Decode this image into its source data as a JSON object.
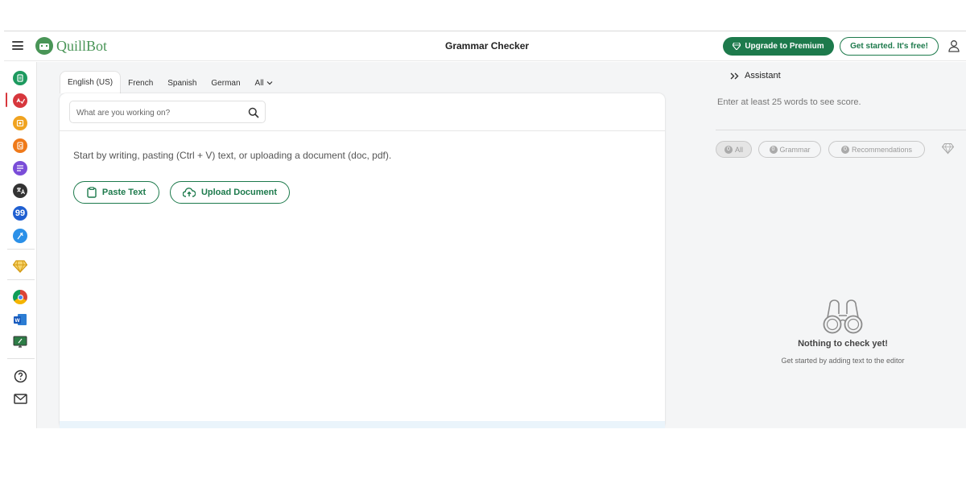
{
  "header": {
    "logo_text": "QuillBot",
    "page_title": "Grammar Checker",
    "upgrade_label": "Upgrade to Premium",
    "get_started_label": "Get started. It's free!"
  },
  "languages": {
    "tabs": [
      {
        "label": "English (US)",
        "active": true
      },
      {
        "label": "French",
        "active": false
      },
      {
        "label": "Spanish",
        "active": false
      },
      {
        "label": "German",
        "active": false
      },
      {
        "label": "All",
        "active": false
      }
    ]
  },
  "editor": {
    "search_placeholder": "What are you working on?",
    "hint": "Start by writing, pasting (Ctrl + V) text, or uploading a document (doc, pdf).",
    "paste_label": "Paste Text",
    "upload_label": "Upload Document"
  },
  "assistant": {
    "title": "Assistant",
    "score_hint": "Enter at least 25 words to see score.",
    "filters": [
      {
        "count": "0",
        "label": "All",
        "active": true
      },
      {
        "count": "0",
        "label": "Grammar",
        "active": false
      },
      {
        "count": "0",
        "label": "Recommendations",
        "active": false
      }
    ],
    "empty_title": "Nothing to check yet!",
    "empty_subtitle": "Get started by adding text to the editor"
  },
  "sidebar": {
    "items": [
      {
        "name": "paraphraser-icon",
        "color": "#1d9a5f"
      },
      {
        "name": "grammar-checker-icon",
        "color": "#d7373d"
      },
      {
        "name": "ai-detector-icon",
        "color": "#f0a320"
      },
      {
        "name": "plagiarism-checker-icon",
        "color": "#ef7a1a"
      },
      {
        "name": "summarizer-icon",
        "color": "#7a4dd8"
      },
      {
        "name": "translator-icon",
        "color": "#333333"
      },
      {
        "name": "citation-generator-icon",
        "color": "#1f5fd1"
      },
      {
        "name": "flow-icon",
        "color": "#2b90e8"
      },
      {
        "name": "premium-diamond-icon",
        "color": "#e8b21a"
      },
      {
        "name": "chrome-extension-icon",
        "color": "#db4437"
      },
      {
        "name": "word-addin-icon",
        "color": "#2b5797"
      },
      {
        "name": "desktop-app-icon",
        "color": "#2d7d46"
      },
      {
        "name": "help-icon",
        "color": "#333333"
      },
      {
        "name": "mail-icon",
        "color": "#333333"
      }
    ]
  },
  "colors": {
    "brand_green": "#1d7a4c",
    "logo_green": "#499557",
    "active_red": "#d7373d"
  }
}
